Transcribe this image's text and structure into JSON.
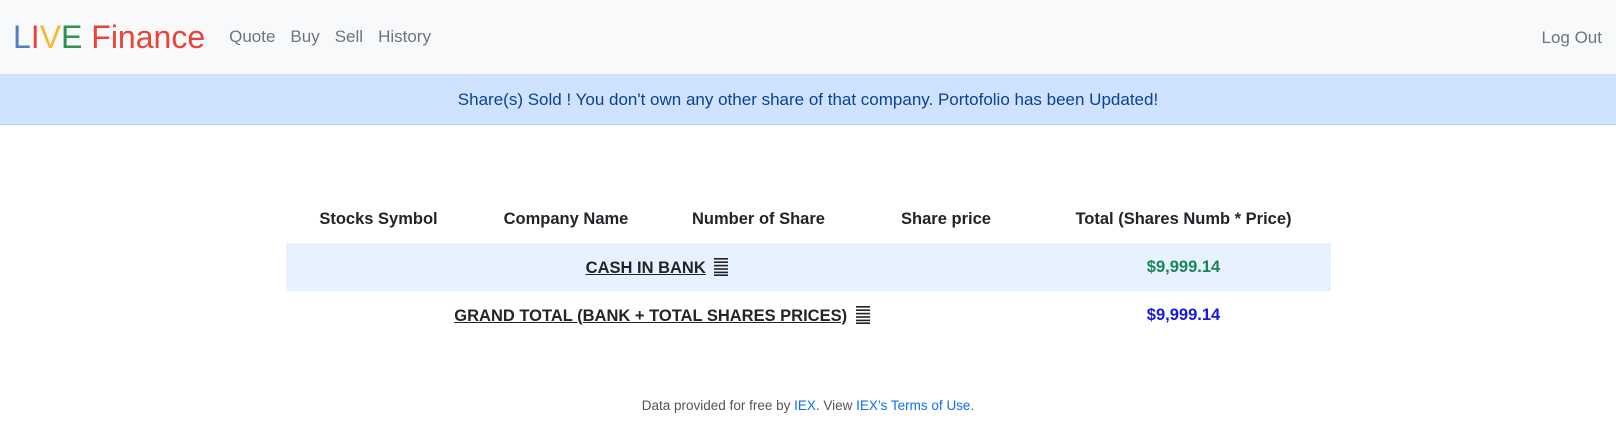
{
  "navbar": {
    "brand": {
      "letters": [
        {
          "text": "L",
          "color": "#537fbe"
        },
        {
          "text": "I",
          "color": "#ea433b"
        },
        {
          "text": "V",
          "color": "#f5b82e"
        },
        {
          "text": "E",
          "color": "#2e944b"
        },
        {
          "text": " Finance",
          "color": "#ea433b"
        }
      ]
    },
    "links": [
      "Quote",
      "Buy",
      "Sell",
      "History"
    ],
    "logout": "Log Out"
  },
  "alert": {
    "message": "Share(s) Sold ! You don't own any other share of that company. Portofolio has been Updated!"
  },
  "portfolio": {
    "headers": [
      "Stocks Symbol",
      "Company Name",
      "Number of Share",
      "Share price",
      "Total (Shares Numb * Price)"
    ],
    "cash": {
      "label": "CASH IN BANK",
      "value": "$9,999.14",
      "icon": "list-lines-icon"
    },
    "grand_total": {
      "label": "GRAND TOTAL (BANK + TOTAL SHARES PRICES)",
      "value": "$9,999.14",
      "icon": "list-lines-icon"
    }
  },
  "footer": {
    "prefix": "Data provided for free by ",
    "iex_link": "IEX",
    "middle": ". View ",
    "terms_link": "IEX’s Terms of Use",
    "suffix": "."
  }
}
